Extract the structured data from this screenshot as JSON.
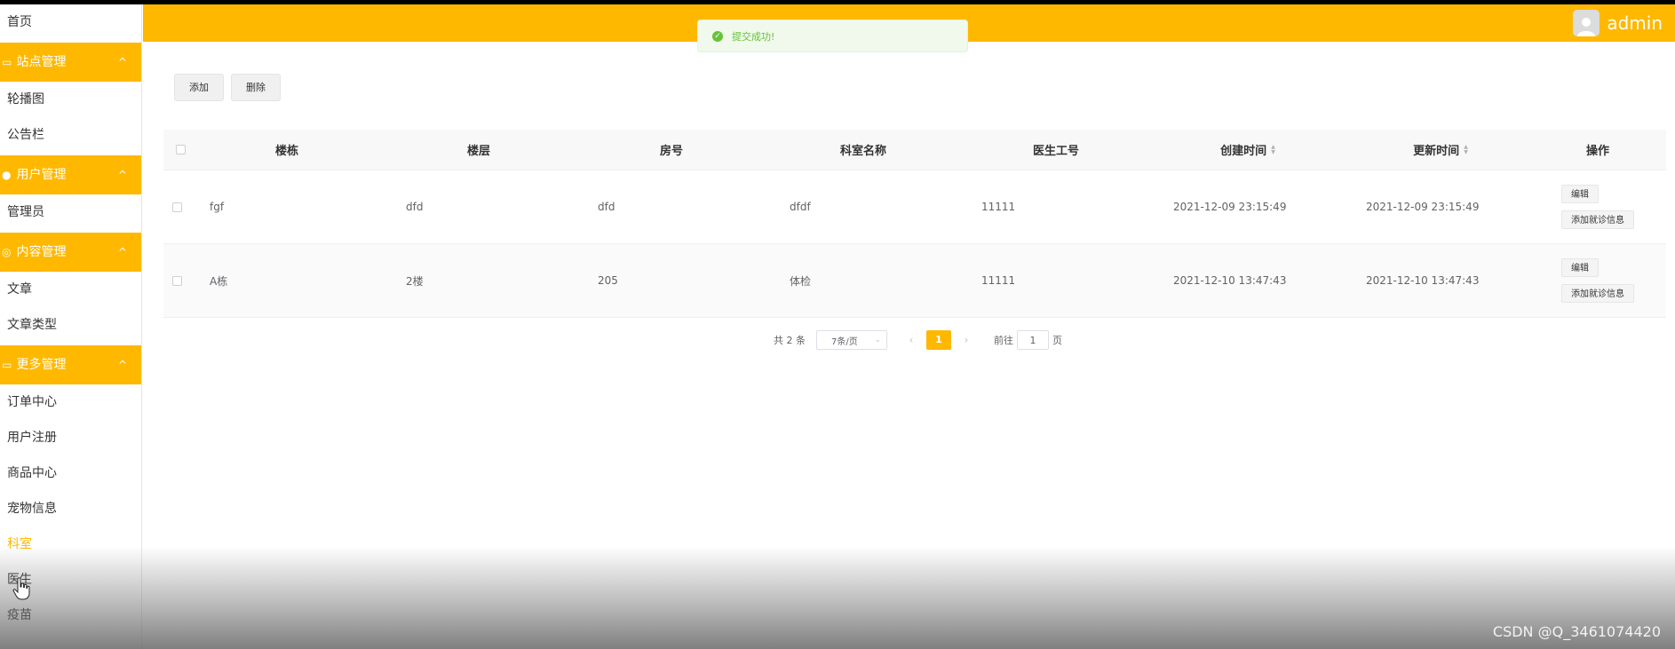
{
  "sidebar": {
    "home": "首页",
    "groups": [
      {
        "label": "站点管理",
        "icon": "monitor-icon",
        "items": [
          "轮播图",
          "公告栏"
        ]
      },
      {
        "label": "用户管理",
        "icon": "user-icon",
        "items": [
          "管理员"
        ]
      },
      {
        "label": "内容管理",
        "icon": "target-icon",
        "items": [
          "文章",
          "文章类型"
        ]
      },
      {
        "label": "更多管理",
        "icon": "monitor-icon",
        "items": [
          "订单中心",
          "用户注册",
          "商品中心",
          "宠物信息",
          "科室",
          "医生",
          "疫苗"
        ]
      }
    ],
    "active_item": "科室"
  },
  "header": {
    "user_name": "admin"
  },
  "toast": {
    "message": "提交成功!"
  },
  "toolbar": {
    "add_label": "添加",
    "delete_label": "删除"
  },
  "table": {
    "columns": [
      "楼栋",
      "楼层",
      "房号",
      "科室名称",
      "医生工号",
      "创建时间",
      "更新时间",
      "操作"
    ],
    "rows": [
      {
        "building": "fgf",
        "floor": "dfd",
        "room": "dfd",
        "dept": "dfdf",
        "doctor_id": "11111",
        "created": "2021-12-09 23:15:49",
        "updated": "2021-12-09 23:15:49"
      },
      {
        "building": "A栋",
        "floor": "2楼",
        "room": "205",
        "dept": "体检",
        "doctor_id": "11111",
        "created": "2021-12-10 13:47:43",
        "updated": "2021-12-10 13:47:43"
      }
    ],
    "edit_label": "编辑",
    "add_visit_label": "添加就诊信息"
  },
  "pagination": {
    "total_text": "共 2 条",
    "page_size": "7条/页",
    "current_page": "1",
    "goto_prefix": "前往",
    "goto_value": "1",
    "goto_suffix": "页"
  },
  "watermark": "CSDN @Q_3461074420",
  "colors": {
    "accent": "#ffb800",
    "success": "#67c23a"
  }
}
